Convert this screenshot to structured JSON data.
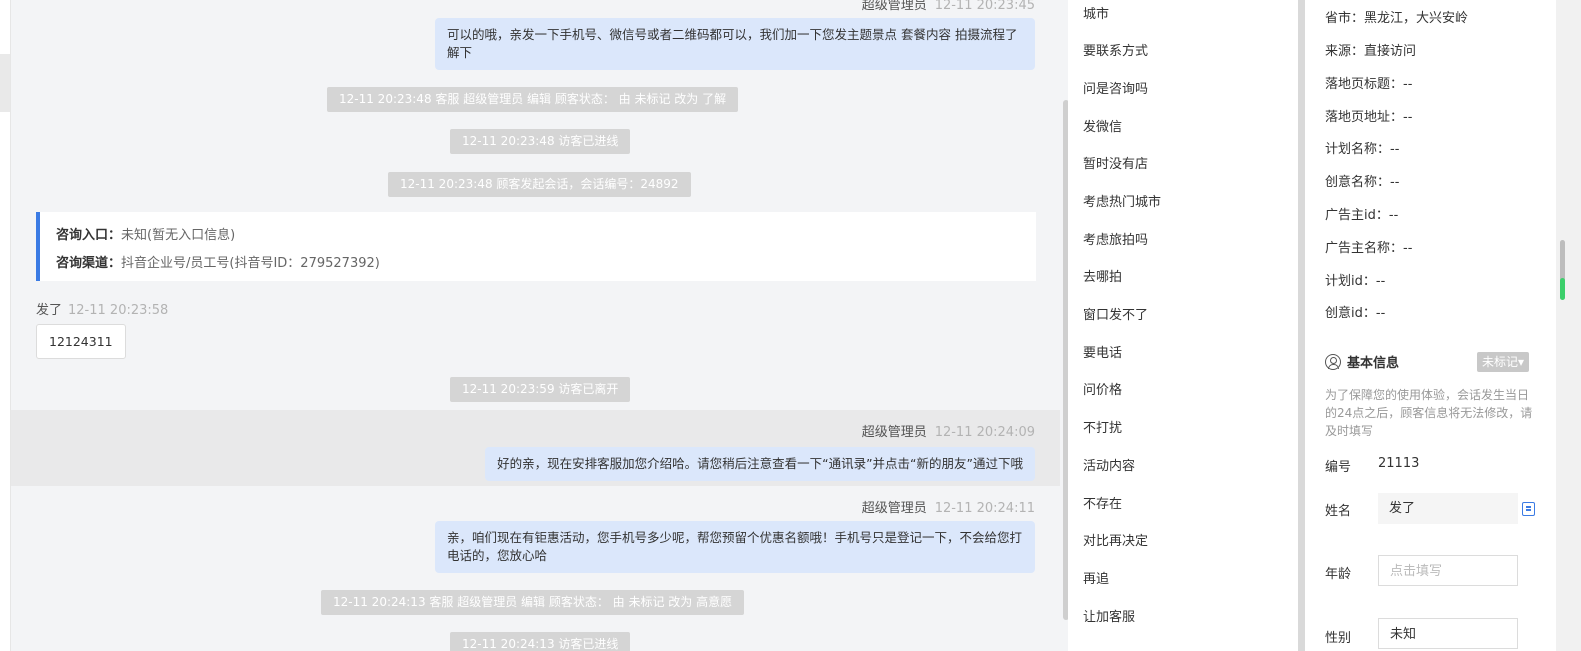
{
  "chat": {
    "msg1": {
      "sender": "超级管理员",
      "time": "12-11 20:23:45",
      "text": "可以的哦，亲发一下手机号、微信号或者二维码都可以，我们加一下您发主题景点 套餐内容 拍摄流程了解下"
    },
    "sys1": "12-11 20:23:48 客服 超级管理员 编辑 顾客状态： 由 未标记 改为 了解",
    "sys2": "12-11 20:23:48 访客已进线",
    "sys3": "12-11 20:23:48 顾客发起会话，会话编号：24892",
    "entry": {
      "label1": "咨询入口：",
      "value1": "未知(暂无入口信息)",
      "label2": "咨询渠道：",
      "value2": "抖音企业号/员工号(抖音号ID：279527392)"
    },
    "visitor": {
      "name": "发了",
      "time": "12-11 20:23:58",
      "text": "12124311"
    },
    "sys4": "12-11 20:23:59 访客已离开",
    "msg2": {
      "sender": "超级管理员",
      "time": "12-11 20:24:09",
      "text": "好的亲，现在安排客服加您介绍哈。请您稍后注意查看一下“通讯录”并点击“新的朋友”通过下哦"
    },
    "msg3": {
      "sender": "超级管理员",
      "time": "12-11 20:24:11",
      "text": "亲，咱们现在有钜惠活动，您手机号多少呢，帮您预留个优惠名额哦！手机号只是登记一下，不会给您打电话的，您放心哈"
    },
    "sys5": "12-11 20:24:13 客服 超级管理员 编辑 顾客状态： 由 未标记 改为 高意愿",
    "sys6": "12-11 20:24:13 访客已进线"
  },
  "quick_replies": [
    "城市",
    "要联系方式",
    "问是咨询吗",
    "发微信",
    "暂时没有店",
    "考虑热门城市",
    "考虑旅拍吗",
    "去哪拍",
    "窗口发不了",
    "要电话",
    "问价格",
    "不打扰",
    "活动内容",
    "不存在",
    "对比再决定",
    "再追",
    "让加客服"
  ],
  "info": {
    "rows": [
      {
        "label": "省市：",
        "value": "黑龙江，大兴安岭"
      },
      {
        "label": "来源：",
        "value": "直接访问"
      },
      {
        "label": "落地页标题：",
        "value": "--"
      },
      {
        "label": "落地页地址：",
        "value": "--"
      },
      {
        "label": "计划名称：",
        "value": "--"
      },
      {
        "label": "创意名称：",
        "value": "--"
      },
      {
        "label": "广告主id：",
        "value": "--"
      },
      {
        "label": "广告主名称：",
        "value": "--"
      },
      {
        "label": "计划id：",
        "value": "--"
      },
      {
        "label": "创意id：",
        "value": "--"
      }
    ],
    "section_title": "基本信息",
    "mark_tag": "未标记▾",
    "notice": "为了保障您的使用体验，会话发生当日的24点之后，顾客信息将无法修改，请及时填写",
    "id_label": "编号",
    "id_value": "21113",
    "name_label": "姓名",
    "name_value": "发了",
    "age_label": "年龄",
    "age_placeholder": "点击填写",
    "gender_label": "性别",
    "gender_value": "未知"
  }
}
